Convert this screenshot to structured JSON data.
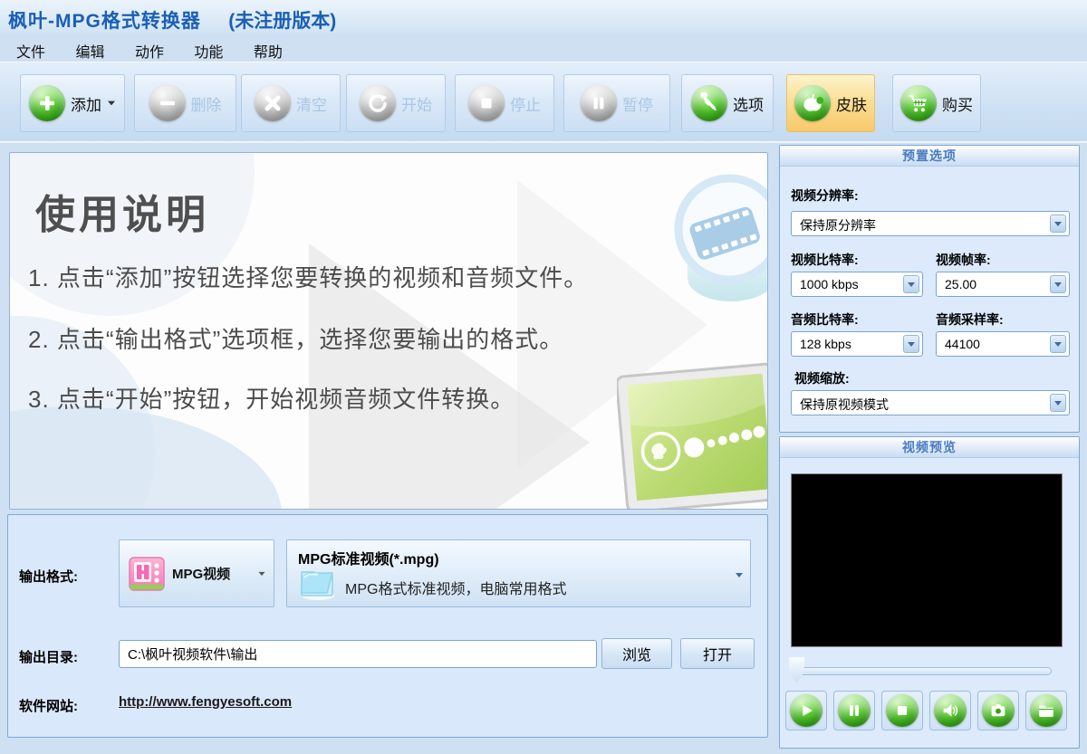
{
  "window": {
    "title": "枫叶-MPG格式转换器",
    "badge": "(未注册版本)"
  },
  "menu": {
    "items": [
      "文件",
      "编辑",
      "动作",
      "功能",
      "帮助"
    ]
  },
  "toolbar": {
    "buttons": [
      {
        "label": "添加",
        "icon": "add-plus-icon",
        "state": "enabled",
        "has_dropdown": true
      },
      {
        "label": "删除",
        "icon": "remove-minus-icon",
        "state": "disabled"
      },
      {
        "label": "清空",
        "icon": "clear-x-icon",
        "state": "disabled"
      },
      {
        "label": "开始",
        "icon": "start-arrow-icon",
        "state": "disabled"
      },
      {
        "label": "停止",
        "icon": "stop-square-icon",
        "state": "disabled"
      },
      {
        "label": "暂停",
        "icon": "pause-icon",
        "state": "disabled"
      },
      {
        "label": "选项",
        "icon": "options-tools-icon",
        "state": "enabled"
      },
      {
        "label": "皮肤",
        "icon": "skin-apple-icon",
        "state": "enabled",
        "highlighted": true
      },
      {
        "label": "购买",
        "icon": "buy-cart-icon",
        "state": "enabled"
      }
    ]
  },
  "instructions": {
    "title": "使用说明",
    "steps": [
      "1. 点击“添加”按钮选择您要转换的视频和音频文件。",
      "2. 点击“输出格式”选项框，选择您要输出的格式。",
      "3. 点击“开始”按钮，开始视频音频文件转换。"
    ]
  },
  "preset_panel": {
    "title": "预置选项",
    "video_resolution": {
      "label": "视频分辨率:",
      "value": "保持原分辨率"
    },
    "video_bitrate": {
      "label": "视频比特率:",
      "value": "1000 kbps"
    },
    "video_framerate": {
      "label": "视频帧率:",
      "value": "25.00"
    },
    "audio_bitrate": {
      "label": "音频比特率:",
      "value": "128 kbps"
    },
    "audio_samplerate": {
      "label": "音频采样率:",
      "value": "44100"
    },
    "video_scale": {
      "label": "视频缩放:",
      "value": "保持原视频模式"
    }
  },
  "preview_panel": {
    "title": "视频预览",
    "controls": [
      "play",
      "pause",
      "stop",
      "volume",
      "snapshot",
      "open-folder"
    ]
  },
  "output": {
    "format_label": "输出格式:",
    "format_value": "MPG视频",
    "format_title": "MPG标准视频(*.mpg)",
    "format_desc": "MPG格式标准视频，电脑常用格式",
    "dir_label": "输出目录:",
    "dir_value": "C:\\枫叶视频软件\\输出",
    "browse_label": "浏览",
    "open_label": "打开",
    "site_label": "软件网站:",
    "site_url": "http://www.fengyesoft.com"
  },
  "colors": {
    "accent_blue": "#1b5fb5",
    "panel_border": "#7fa8d7",
    "panel_bg": "#dceafb",
    "enabled_green": "#2aa30d",
    "skin_highlight": "#f7c869",
    "format_icon_pink": "#f26bb0"
  }
}
